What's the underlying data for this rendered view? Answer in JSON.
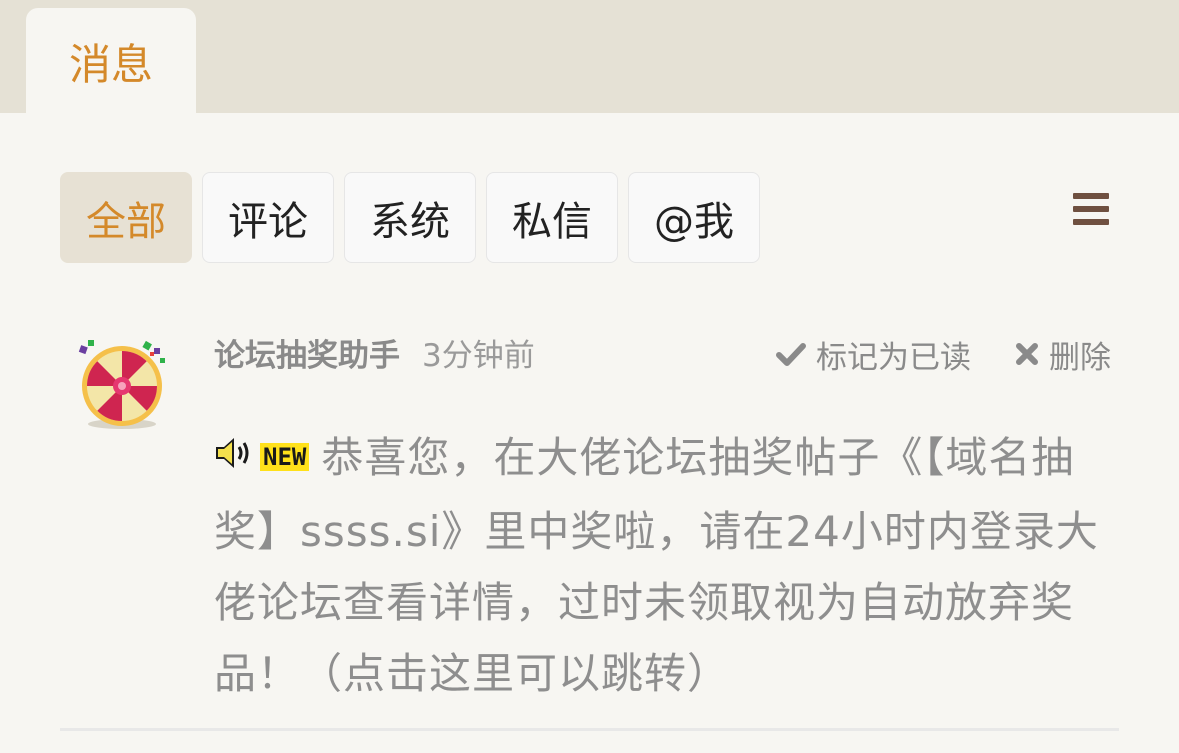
{
  "header": {
    "tab_label": "消息"
  },
  "filters": [
    {
      "label": "全部",
      "active": true
    },
    {
      "label": "评论",
      "active": false
    },
    {
      "label": "系统",
      "active": false
    },
    {
      "label": "私信",
      "active": false
    },
    {
      "label": "@我",
      "active": false
    }
  ],
  "menu_icon": "hamburger-menu-icon",
  "message": {
    "avatar_icon": "prize-wheel-icon",
    "sender": "论坛抽奖助手",
    "time": "3分钟前",
    "mark_read_label": "标记为已读",
    "delete_label": "删除",
    "badge_text": "NEW",
    "content": "恭喜您，在大佬论坛抽奖帖子《【域名抽奖】ssss.si》里中奖啦，请在24小时内登录大佬论坛查看详情，过时未领取视为自动放弃奖品！（点击这里可以跳转）"
  },
  "colors": {
    "accent": "#d4892a",
    "topbar": "#e5e1d5",
    "background": "#f7f6f2",
    "menu_icon": "#6f5040",
    "muted_text": "#8e8e8e"
  }
}
